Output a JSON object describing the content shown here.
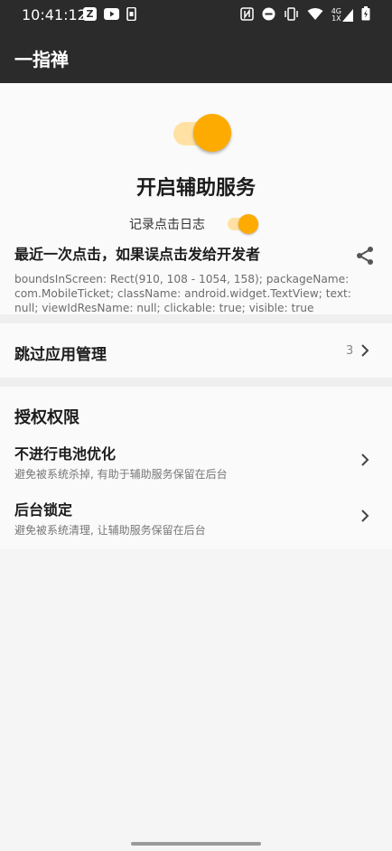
{
  "status_bar": {
    "time": "10:41:12",
    "left_icons": [
      "Z",
      "youtube-icon",
      "phone-icon"
    ],
    "network_label_top": "4G",
    "network_label_bottom": "1X"
  },
  "app_bar": {
    "title": "一指禅"
  },
  "service": {
    "title": "开启辅助服务",
    "enabled": true,
    "log_label": "记录点击日志",
    "log_enabled": true
  },
  "last_click": {
    "title": "最近一次点击，如果误点击发给开发者",
    "detail": "boundsInScreen: Rect(910, 108 - 1054, 158); packageName: com.MobileTicket; className: android.widget.TextView; text: null; viewIdResName: null; clickable: true; visible: true"
  },
  "skip_apps": {
    "label": "跳过应用管理",
    "count": "3"
  },
  "permissions": {
    "header": "授权权限",
    "items": [
      {
        "title": "不进行电池优化",
        "subtitle": "避免被系统杀掉, 有助于辅助服务保留在后台"
      },
      {
        "title": "后台锁定",
        "subtitle": "避免被系统清理, 让辅助服务保留在后台"
      }
    ]
  },
  "colors": {
    "accent": "#fdab00",
    "accent_track": "#ffe2a3",
    "bar": "#2b2b2b"
  }
}
